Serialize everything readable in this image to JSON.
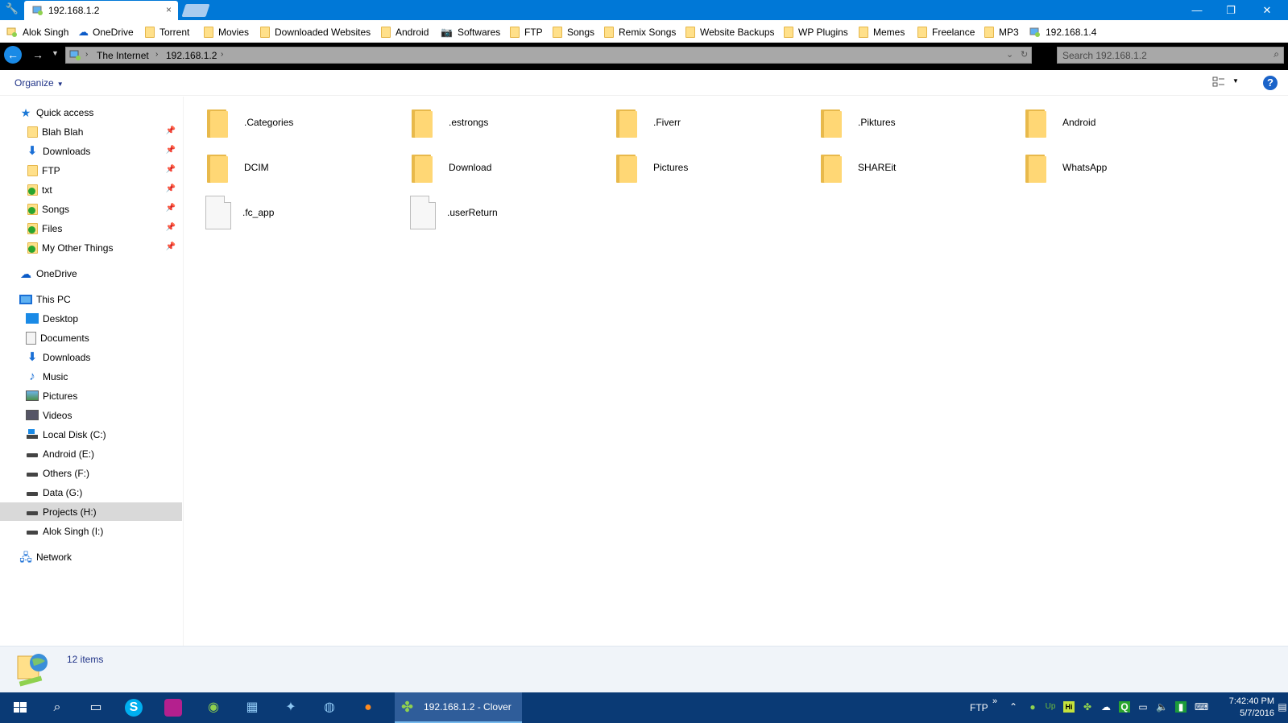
{
  "window": {
    "tab_title": "192.168.1.2",
    "tab_close": "×",
    "minimize": "—",
    "restore": "❐",
    "close": "✕"
  },
  "bookmarks": [
    {
      "label": "Alok Singh",
      "icon": "network-place-icon"
    },
    {
      "label": "OneDrive",
      "icon": "onedrive-icon"
    },
    {
      "label": "Torrent",
      "icon": "folder-icon"
    },
    {
      "label": "Movies",
      "icon": "folder-icon"
    },
    {
      "label": "Downloaded Websites",
      "icon": "folder-icon"
    },
    {
      "label": "Android",
      "icon": "folder-icon"
    },
    {
      "label": "Softwares",
      "icon": "camera-icon"
    },
    {
      "label": "FTP",
      "icon": "folder-icon"
    },
    {
      "label": "Songs",
      "icon": "folder-icon"
    },
    {
      "label": "Remix Songs",
      "icon": "folder-icon"
    },
    {
      "label": "Website Backups",
      "icon": "folder-icon"
    },
    {
      "label": "WP Plugins",
      "icon": "folder-icon"
    },
    {
      "label": "Memes",
      "icon": "folder-icon"
    },
    {
      "label": "Freelance",
      "icon": "folder-icon"
    },
    {
      "label": "MP3",
      "icon": "folder-icon"
    },
    {
      "label": "192.168.1.4",
      "icon": "network-place-icon"
    }
  ],
  "address": {
    "crumbs": [
      "The Internet",
      "192.168.1.2"
    ],
    "search_placeholder": "Search 192.168.1.2"
  },
  "command_bar": {
    "organize_label": "Organize"
  },
  "nav_pane": {
    "quick_access": "Quick access",
    "quick_items": [
      "Blah Blah",
      "Downloads",
      "FTP",
      "txt",
      "Songs",
      "Files",
      "My Other Things"
    ],
    "onedrive": "OneDrive",
    "this_pc": "This PC",
    "pc_items": [
      "Desktop",
      "Documents",
      "Downloads",
      "Music",
      "Pictures",
      "Videos",
      "Local Disk (C:)",
      "Android (E:)",
      "Others (F:)",
      "Data (G:)",
      "Projects (H:)",
      "Alok Singh (I:)"
    ],
    "network": "Network",
    "selected": "Projects (H:)"
  },
  "content": {
    "folders": [
      ".Categories",
      ".estrongs",
      ".Fiverr",
      ".Piktures",
      "Android",
      "DCIM",
      "Download",
      "Pictures",
      "SHAREit",
      "WhatsApp"
    ],
    "files": [
      ".fc_app",
      ".userReturn"
    ]
  },
  "details": {
    "count_text": "12 items"
  },
  "taskbar": {
    "active_window": "192.168.1.2 - Clover",
    "tray_label": "FTP",
    "tray_chevron": "»",
    "time": "7:42:40 PM",
    "date": "5/7/2016"
  },
  "colors": {
    "accent": "#0078d7",
    "taskbar": "#0a3a75",
    "folder": "#ffd775"
  }
}
